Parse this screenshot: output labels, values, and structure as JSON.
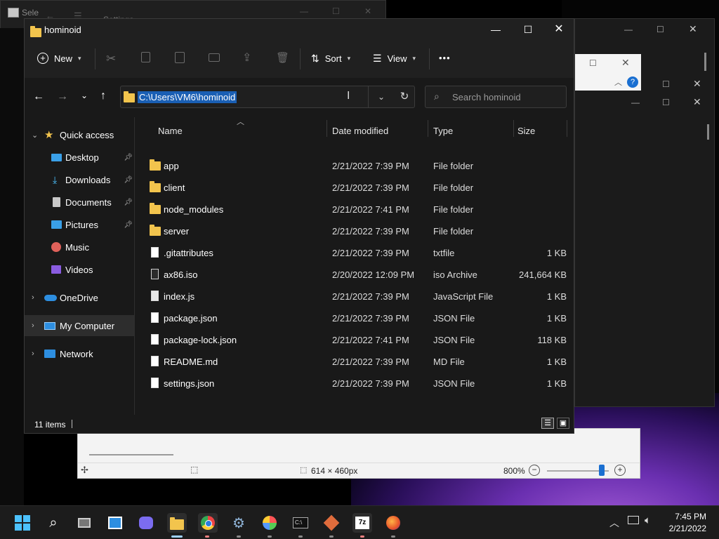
{
  "background": {
    "console_title": "Sele",
    "settings_title": "Settings",
    "paint_status_size": "614 × 460px",
    "paint_zoom": "800%"
  },
  "explorer": {
    "title": "hominoid",
    "toolbar": {
      "new_label": "New",
      "sort_label": "Sort",
      "view_label": "View",
      "more_label": "•••"
    },
    "address": "C:\\Users\\VM6\\hominoid",
    "search_placeholder": "Search hominoid",
    "sidebar": {
      "quick_access": "Quick access",
      "items": [
        {
          "label": "Desktop",
          "icon": "desktop-icon",
          "color": "#3aa0e8"
        },
        {
          "label": "Downloads",
          "icon": "downloads-icon",
          "color": "#4cc2ff"
        },
        {
          "label": "Documents",
          "icon": "documents-icon",
          "color": "#c8c8c8"
        },
        {
          "label": "Pictures",
          "icon": "pictures-icon",
          "color": "#3aa0e8"
        },
        {
          "label": "Music",
          "icon": "music-icon",
          "color": "#e0615a"
        },
        {
          "label": "Videos",
          "icon": "videos-icon",
          "color": "#8a5ce0"
        }
      ],
      "onedrive": "OneDrive",
      "my_computer": "My Computer",
      "network": "Network"
    },
    "columns": {
      "name": "Name",
      "date": "Date modified",
      "type": "Type",
      "size": "Size"
    },
    "files": [
      {
        "name": "app",
        "date": "2/21/2022 7:39 PM",
        "type": "File folder",
        "size": "",
        "kind": "folder"
      },
      {
        "name": "client",
        "date": "2/21/2022 7:39 PM",
        "type": "File folder",
        "size": "",
        "kind": "folder"
      },
      {
        "name": "node_modules",
        "date": "2/21/2022 7:41 PM",
        "type": "File folder",
        "size": "",
        "kind": "folder"
      },
      {
        "name": "server",
        "date": "2/21/2022 7:39 PM",
        "type": "File folder",
        "size": "",
        "kind": "folder"
      },
      {
        "name": ".gitattributes",
        "date": "2/21/2022 7:39 PM",
        "type": "txtfile",
        "size": "1 KB",
        "kind": "file"
      },
      {
        "name": "ax86.iso",
        "date": "2/20/2022 12:09 PM",
        "type": "iso Archive",
        "size": "241,664 KB",
        "kind": "iso"
      },
      {
        "name": "index.js",
        "date": "2/21/2022 7:39 PM",
        "type": "JavaScript File",
        "size": "1 KB",
        "kind": "js"
      },
      {
        "name": "package.json",
        "date": "2/21/2022 7:39 PM",
        "type": "JSON File",
        "size": "1 KB",
        "kind": "file"
      },
      {
        "name": "package-lock.json",
        "date": "2/21/2022 7:41 PM",
        "type": "JSON File",
        "size": "118 KB",
        "kind": "file"
      },
      {
        "name": "README.md",
        "date": "2/21/2022 7:39 PM",
        "type": "MD File",
        "size": "1 KB",
        "kind": "file"
      },
      {
        "name": "settings.json",
        "date": "2/21/2022 7:39 PM",
        "type": "JSON File",
        "size": "1 KB",
        "kind": "file"
      }
    ],
    "status": "11 items"
  },
  "taskbar": {
    "time": "7:45 PM",
    "date": "2/21/2022",
    "sevenzip_label": "7z",
    "apps": [
      "start-icon",
      "search-icon",
      "task-view-icon",
      "widgets-icon",
      "chat-icon",
      "file-explorer-icon",
      "chrome-icon",
      "settings-icon",
      "paint-icon",
      "terminal-icon",
      "git-icon",
      "7zip-icon",
      "firefox-icon"
    ]
  },
  "colors": {
    "accent": "#0078d4",
    "selection": "#1a5fb4",
    "folder": "#f2c44d"
  }
}
